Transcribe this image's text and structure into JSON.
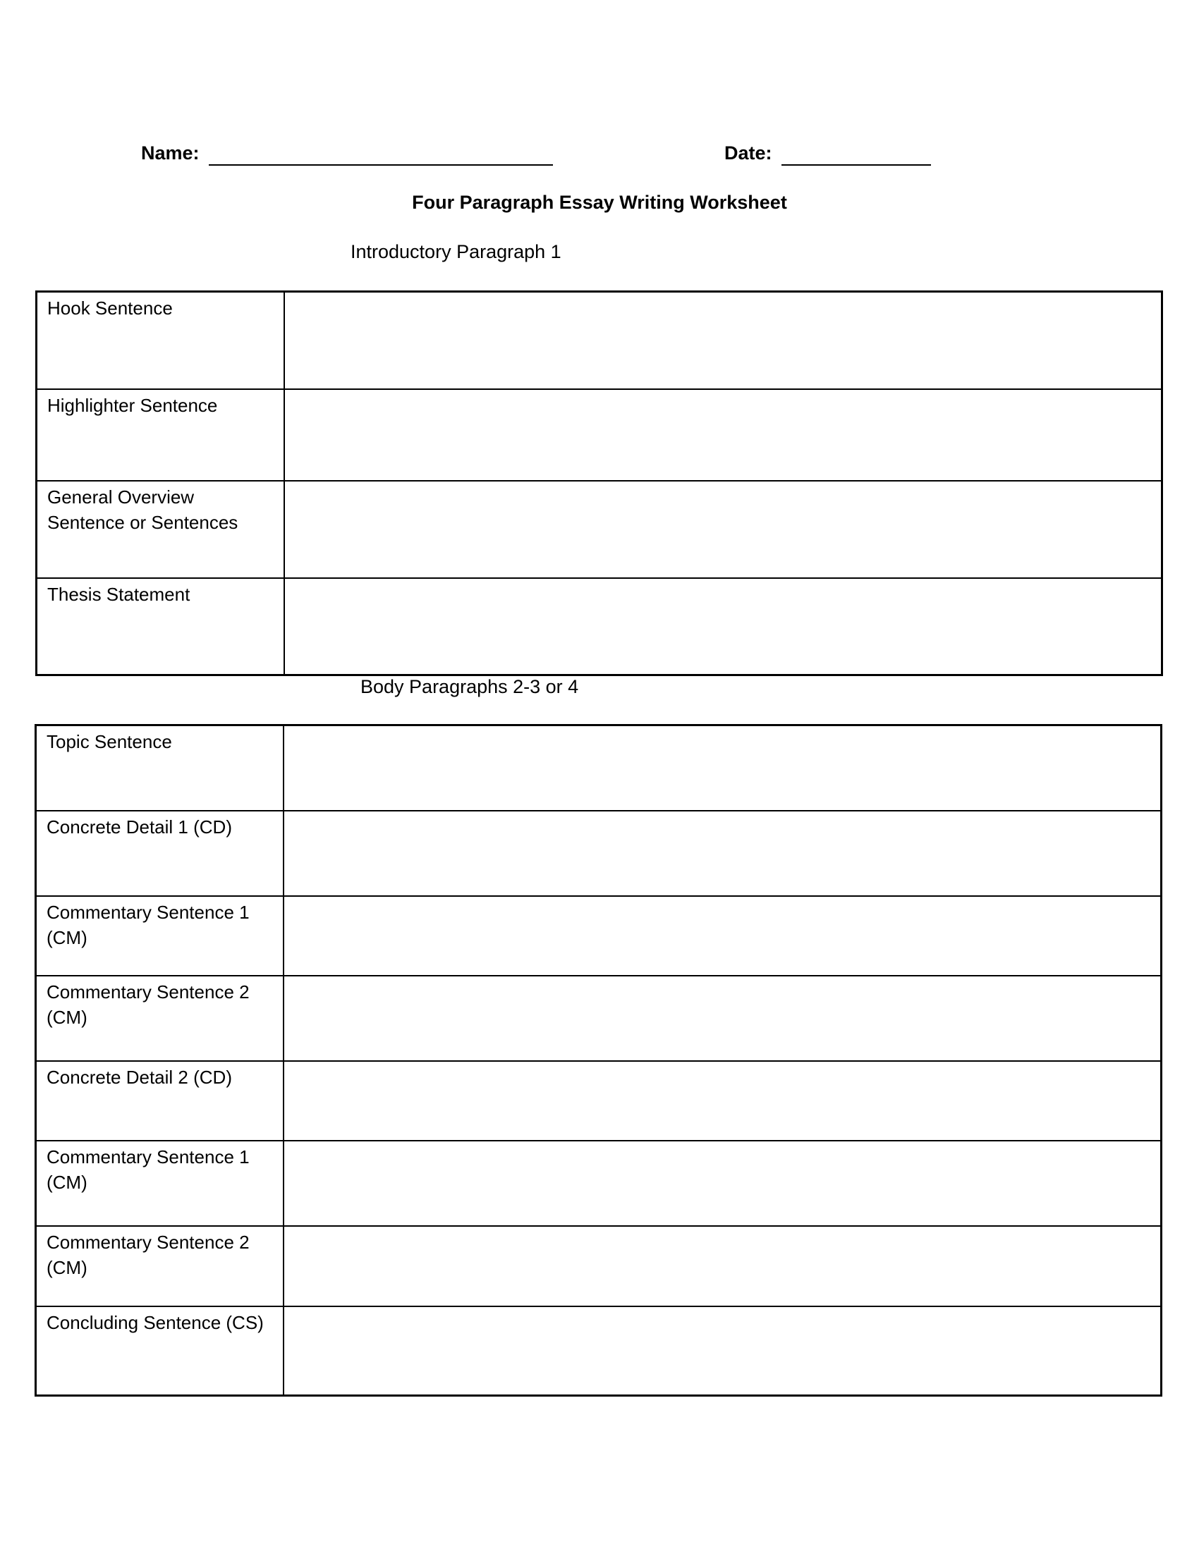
{
  "header": {
    "name_label": "Name:",
    "date_label": "Date:"
  },
  "title": "Four Paragraph Essay Writing Worksheet",
  "intro": {
    "heading": "Introductory Paragraph 1",
    "rows": [
      {
        "label": "Hook Sentence"
      },
      {
        "label": "Highlighter Sentence"
      },
      {
        "label": "General Overview Sentence or Sentences"
      },
      {
        "label": "Thesis Statement"
      }
    ]
  },
  "body": {
    "heading": "Body Paragraphs 2-3 or 4",
    "rows": [
      {
        "label": "Topic Sentence"
      },
      {
        "label": "Concrete Detail 1 (CD)"
      },
      {
        "label": "Commentary Sentence 1 (CM)"
      },
      {
        "label": "Commentary Sentence 2 (CM)"
      },
      {
        "label": "Concrete Detail 2 (CD)"
      },
      {
        "label": "Commentary Sentence 1 (CM)"
      },
      {
        "label": "Commentary Sentence 2 (CM)"
      },
      {
        "label": "Concluding Sentence (CS)"
      }
    ]
  }
}
